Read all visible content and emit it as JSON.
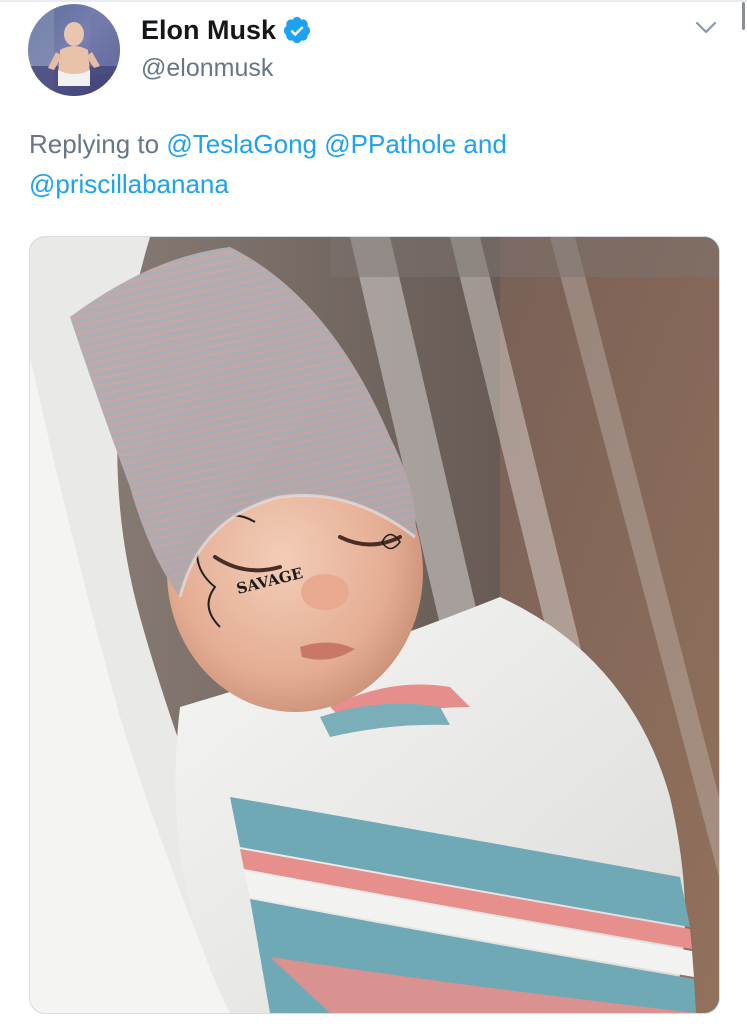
{
  "tweet": {
    "author": {
      "display_name": "Elon Musk",
      "handle": "@elonmusk",
      "verified": true,
      "avatar_icon": "profile-avatar"
    },
    "menu_icon": "chevron-down-icon",
    "reply": {
      "prefix": "Replying to",
      "mentions": [
        "@TeslaGong",
        "@PPathole",
        "@priscillabanana"
      ],
      "conjunction": "and"
    },
    "media": {
      "photo_text": [
        "SAVAGE"
      ]
    }
  },
  "colors": {
    "link": "#1da1f2",
    "muted": "#657786",
    "name": "#14171a",
    "verified_badge": "#1da1f2"
  }
}
